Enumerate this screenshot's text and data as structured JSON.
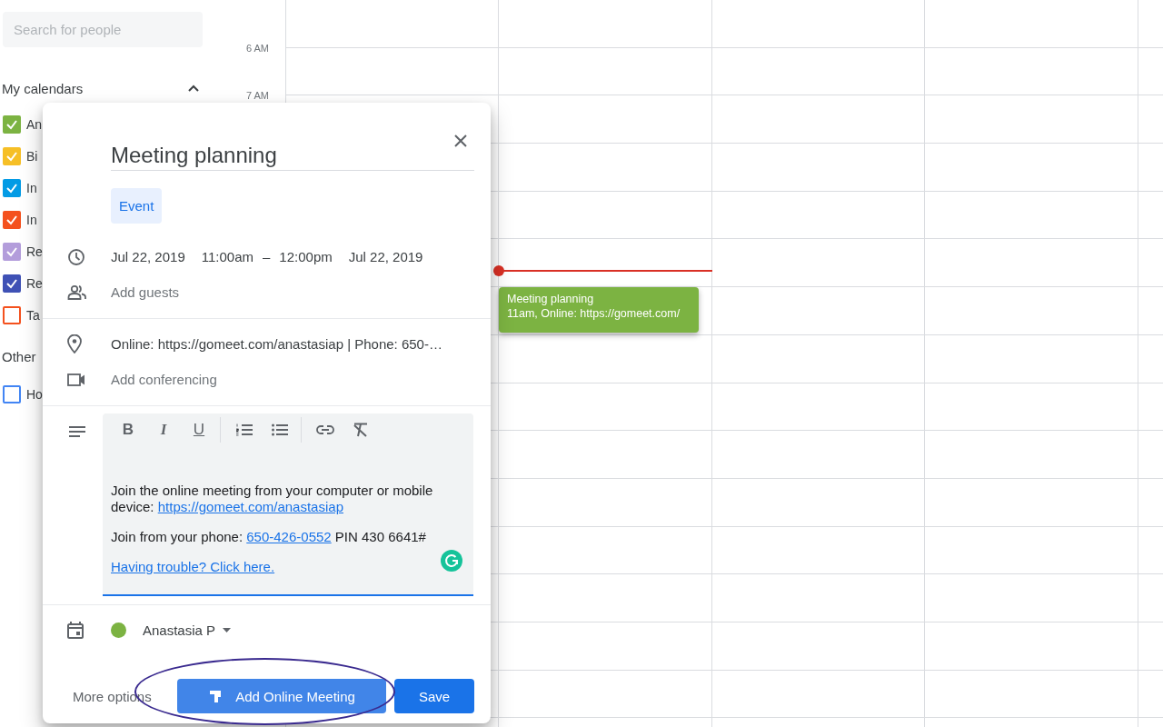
{
  "sidebar": {
    "search": {
      "placeholder": "Search for people"
    },
    "my_calendars": {
      "title": "My calendars",
      "expanded": true,
      "items": [
        {
          "label": "An",
          "checked": true,
          "color": "#7cb342"
        },
        {
          "label": "Bi",
          "checked": true,
          "color": "#f6bf26"
        },
        {
          "label": "In",
          "checked": true,
          "color": "#039be5"
        },
        {
          "label": "In",
          "checked": true,
          "color": "#f4511e"
        },
        {
          "label": "Re",
          "checked": true,
          "color": "#b39ddb"
        },
        {
          "label": "Re",
          "checked": true,
          "color": "#3f51b5"
        },
        {
          "label": "Ta",
          "checked": false,
          "color": "#f4511e"
        }
      ]
    },
    "other_calendars": {
      "title": "Other",
      "items": [
        {
          "label": "Ho",
          "checked": false,
          "color": "#4285f4"
        }
      ]
    }
  },
  "time_labels": [
    "6 AM",
    "7 AM"
  ],
  "event": {
    "title": "Meeting planning",
    "details": "11am, Online: https://gomeet.com/"
  },
  "dialog": {
    "title": "Meeting planning",
    "type_chip": "Event",
    "start_date": "Jul 22, 2019",
    "start_time": "11:00am",
    "dash": "–",
    "end_time": "12:00pm",
    "end_date": "Jul 22, 2019",
    "guests": {
      "placeholder": "Add guests"
    },
    "location": "Online: https://gomeet.com/anastasiap | Phone: 650-…",
    "conferencing": "Add conferencing",
    "toolbar": [
      {
        "kind": "bold",
        "label": "B"
      },
      {
        "kind": "italic",
        "label": "I"
      },
      {
        "kind": "underline",
        "label": "U"
      },
      {
        "kind": "separator"
      },
      {
        "kind": "numbered_list"
      },
      {
        "kind": "bulleted_list"
      },
      {
        "kind": "separator"
      },
      {
        "kind": "link"
      },
      {
        "kind": "clear_format"
      }
    ],
    "description": [
      {
        "text": "Join the online meeting from your computer or mobile device: ",
        "link": "https://gomeet.com/anastasiap"
      },
      {
        "text": "Join from your phone: ",
        "link": "650-426-0552",
        "after": " PIN 430 6641#"
      },
      {
        "link": "Having trouble? Click here."
      }
    ],
    "calendar_owner": "Anastasia P",
    "more_options": "More options",
    "add_meeting_button": "Add Online Meeting",
    "save_button": "Save"
  }
}
